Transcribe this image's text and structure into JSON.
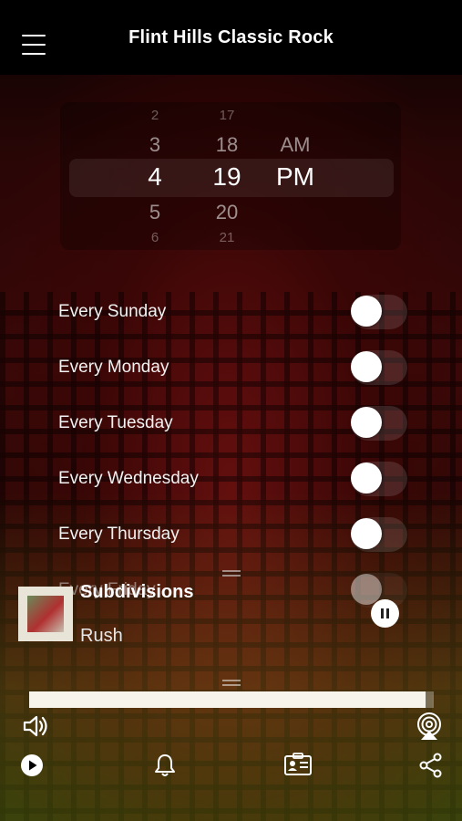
{
  "header": {
    "title": "Flint Hills Classic Rock"
  },
  "picker": {
    "hours": [
      "2",
      "3",
      "4",
      "5",
      "6"
    ],
    "minutes": [
      "17",
      "18",
      "19",
      "20",
      "21"
    ],
    "periods": [
      "AM",
      "PM"
    ],
    "selected": {
      "hour": "4",
      "minute": "19",
      "period": "PM"
    }
  },
  "days": [
    {
      "label": "Every Sunday",
      "on": false
    },
    {
      "label": "Every Monday",
      "on": false
    },
    {
      "label": "Every Tuesday",
      "on": false
    },
    {
      "label": "Every Wednesday",
      "on": false
    },
    {
      "label": "Every Thursday",
      "on": false
    },
    {
      "label": "Every Friday",
      "on": false
    }
  ],
  "now_playing": {
    "title": "Subdivisions",
    "artist": "Rush",
    "progress": 0.98
  },
  "icons": {
    "menu": "menu-icon",
    "volume": "speaker-icon",
    "airplay": "airplay-icon",
    "play": "play-icon",
    "alarm": "bell-icon",
    "contact": "contact-card-icon",
    "share": "share-icon"
  }
}
